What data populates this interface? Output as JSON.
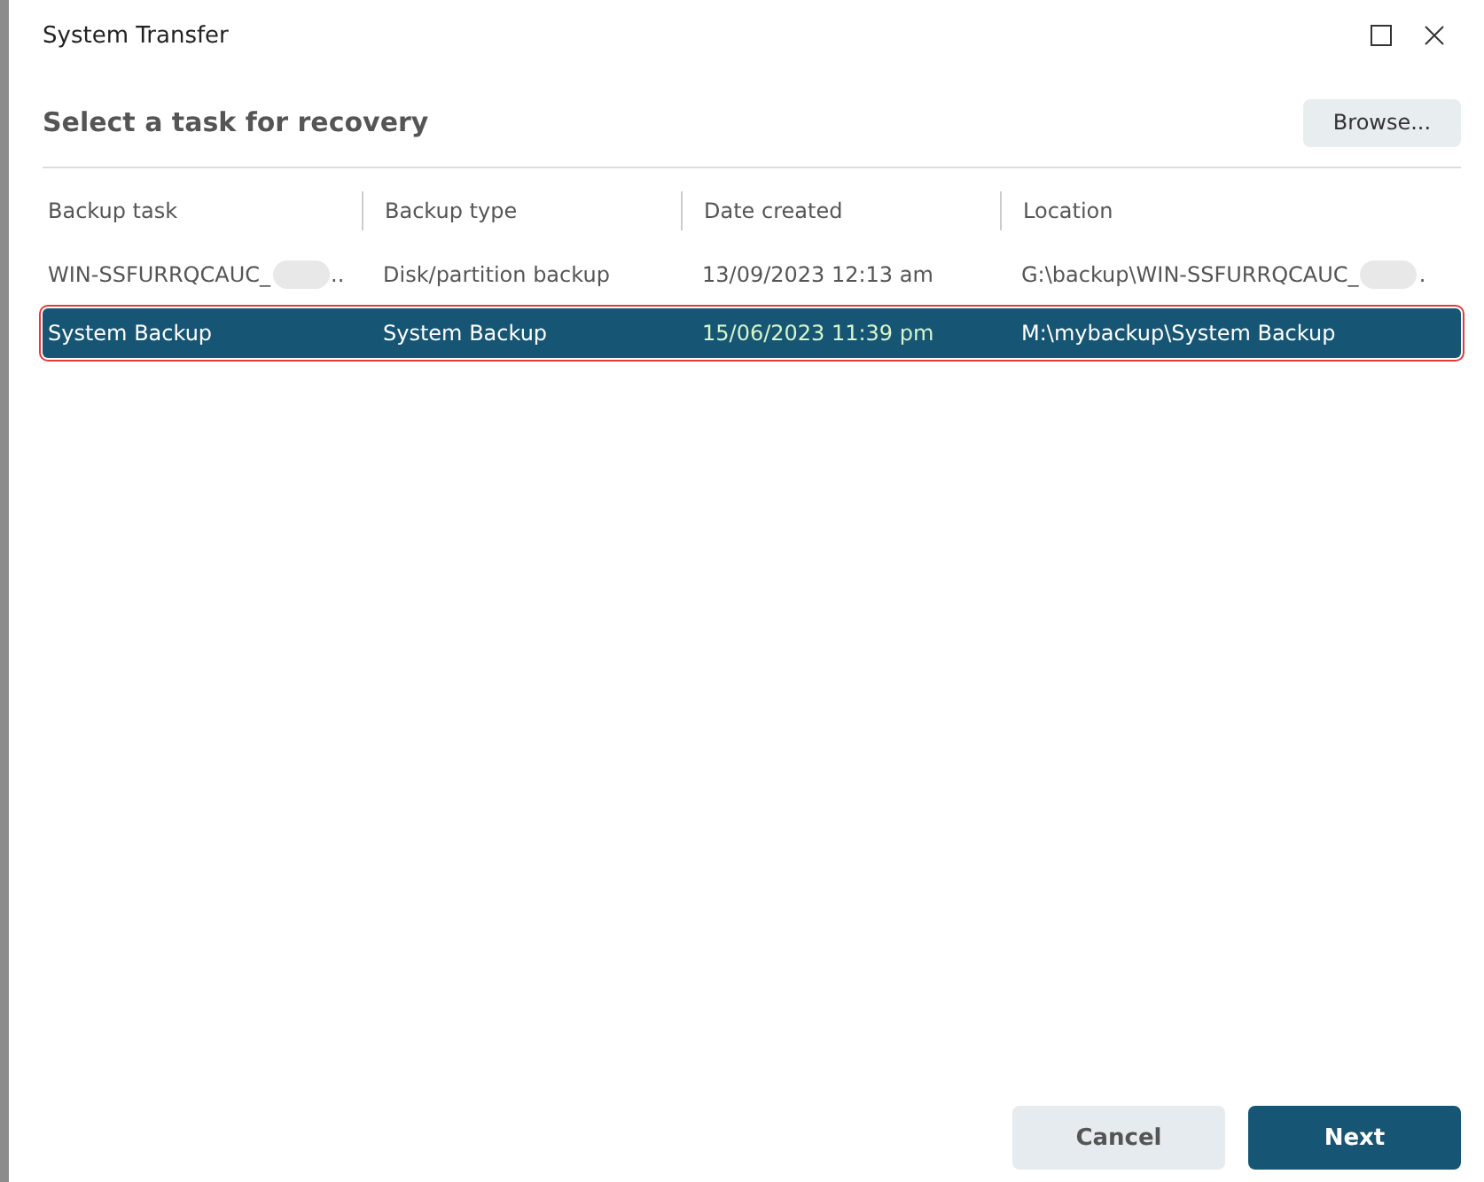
{
  "window": {
    "title": "System Transfer"
  },
  "heading": "Select a task for recovery",
  "browse_button": "Browse...",
  "table": {
    "columns": [
      "Backup task",
      "Backup type",
      "Date created",
      "Location"
    ],
    "rows": [
      {
        "selected": false,
        "highlighted": false,
        "cells": [
          {
            "text": "WIN-SSFURRQCAUC_",
            "redacted": true,
            "tail": ".."
          },
          {
            "text": "Disk/partition backup"
          },
          {
            "text": "13/09/2023 12:13 am"
          },
          {
            "text": "G:\\backup\\WIN-SSFURRQCAUC_",
            "redacted": true,
            "tail": "."
          }
        ]
      },
      {
        "selected": true,
        "highlighted": true,
        "cells": [
          {
            "text": "System Backup"
          },
          {
            "text": "System Backup"
          },
          {
            "text": "15/06/2023 11:39 pm"
          },
          {
            "text": "M:\\mybackup\\System Backup"
          }
        ]
      }
    ]
  },
  "buttons": [
    {
      "label": "Cancel",
      "kind": "secondary"
    },
    {
      "label": "Next",
      "kind": "primary"
    }
  ]
}
